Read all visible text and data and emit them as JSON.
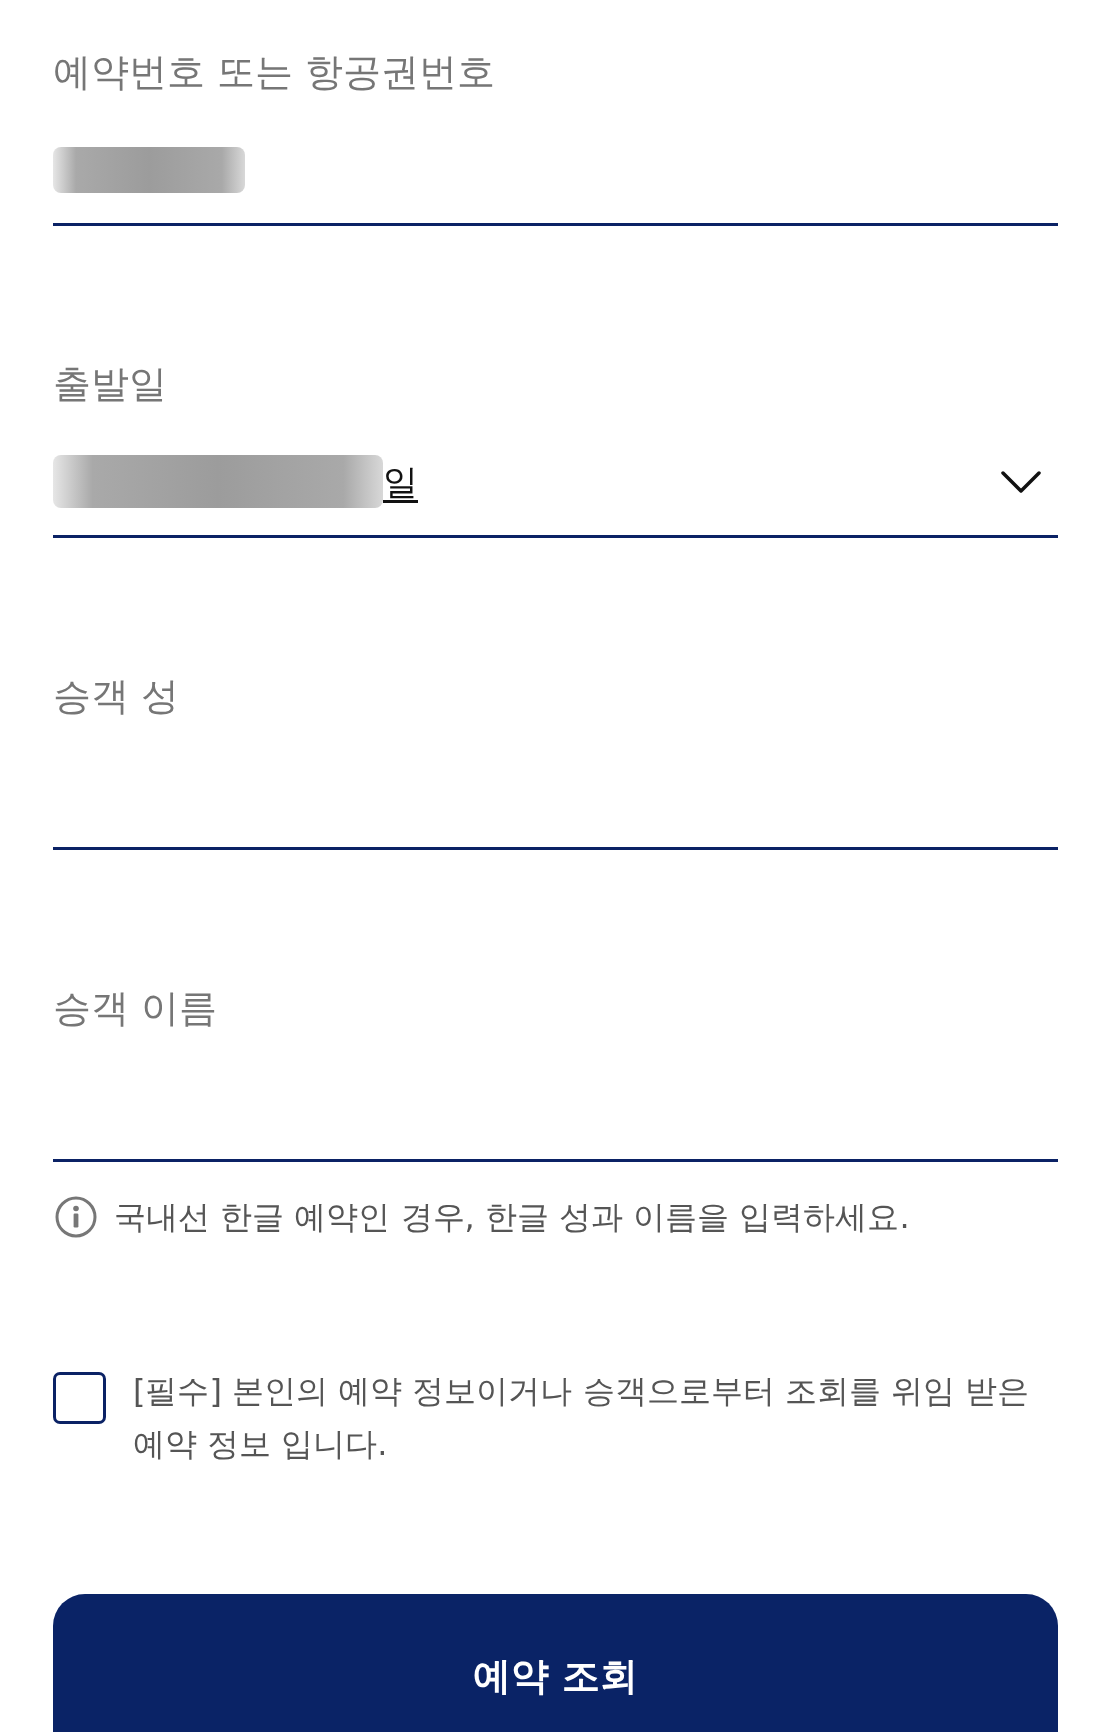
{
  "fields": [
    {
      "kind": "text",
      "label": "예약번호 또는 항공권번호",
      "redacted": true
    },
    {
      "kind": "select",
      "label": "출발일",
      "redacted": true,
      "value": "일"
    },
    {
      "kind": "text",
      "label": "승객 성",
      "redacted": false
    },
    {
      "kind": "text",
      "label": "승객 이름",
      "redacted": false
    }
  ],
  "notice": {
    "text": "국내선 한글 예약인 경우, 한글 성과 이름을 입력하세요."
  },
  "agreement": {
    "checked": false,
    "text": "[필수] 본인의 예약 정보이거나 승객으로부터 조회를 위임 받은 예약 정보 입니다."
  },
  "submit_button": {
    "label": "예약 조회"
  }
}
